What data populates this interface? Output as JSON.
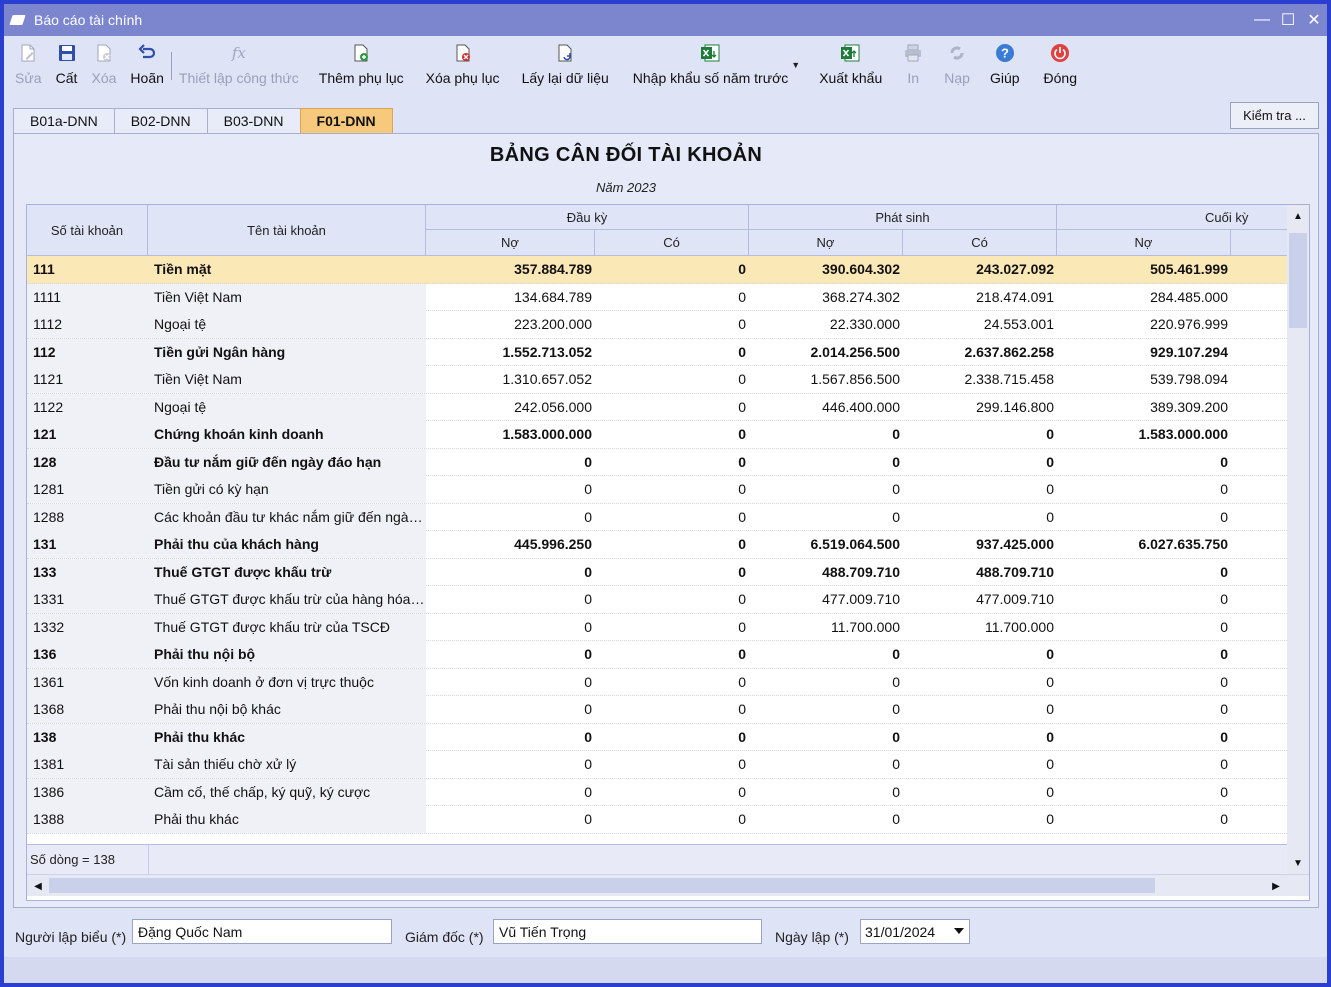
{
  "window": {
    "title": "Báo cáo tài chính"
  },
  "toolbar": {
    "items": [
      {
        "id": "edit",
        "label": "Sửa",
        "icon": "edit-doc-icon",
        "enabled": false
      },
      {
        "id": "save",
        "label": "Cất",
        "icon": "save-disk-icon",
        "enabled": true
      },
      {
        "id": "delete",
        "label": "Xóa",
        "icon": "delete-doc-icon",
        "enabled": false
      },
      {
        "id": "undo",
        "label": "Hoãn",
        "icon": "undo-arrow-icon",
        "enabled": true
      },
      {
        "id": "formula",
        "label": "Thiết lập công thức",
        "icon": "fx-formula-icon",
        "enabled": false
      },
      {
        "id": "add-appendix",
        "label": "Thêm phụ lục",
        "icon": "add-doc-icon",
        "enabled": true
      },
      {
        "id": "remove-appendix",
        "label": "Xóa phụ lục",
        "icon": "remove-doc-icon",
        "enabled": true
      },
      {
        "id": "reload",
        "label": "Lấy lại dữ liệu",
        "icon": "refresh-doc-icon",
        "enabled": true
      },
      {
        "id": "import",
        "label": "Nhập khẩu số năm trước",
        "icon": "excel-import-icon",
        "enabled": true
      },
      {
        "id": "export",
        "label": "Xuất khẩu",
        "icon": "excel-export-icon",
        "enabled": true
      },
      {
        "id": "print",
        "label": "In",
        "icon": "printer-icon",
        "enabled": false
      },
      {
        "id": "load",
        "label": "Nạp",
        "icon": "load-cycle-icon",
        "enabled": false
      },
      {
        "id": "help",
        "label": "Giúp",
        "icon": "help-icon",
        "enabled": true
      },
      {
        "id": "close",
        "label": "Đóng",
        "icon": "power-close-icon",
        "enabled": true
      }
    ]
  },
  "tabs": [
    {
      "label": "B01a-DNN",
      "active": false
    },
    {
      "label": "B02-DNN",
      "active": false
    },
    {
      "label": "B03-DNN",
      "active": false
    },
    {
      "label": "F01-DNN",
      "active": true
    }
  ],
  "check_button": {
    "label": "Kiểm tra ..."
  },
  "report": {
    "title": "BẢNG CÂN ĐỐI TÀI KHOẢN",
    "year": "Năm 2023"
  },
  "grid": {
    "headers": {
      "account_code": "Số tài khoản",
      "account_name": "Tên tài khoản",
      "opening": "Đầu kỳ",
      "movement": "Phát sinh",
      "closing": "Cuối kỳ",
      "debit": "Nợ",
      "credit": "Có"
    },
    "rows": [
      {
        "code": "111",
        "name": "Tiền mặt",
        "open_debit": "357.884.789",
        "open_credit": "0",
        "mov_debit": "390.604.302",
        "mov_credit": "243.027.092",
        "close_debit": "505.461.999",
        "bold": true,
        "selected": true
      },
      {
        "code": "1111",
        "name": "Tiền Việt Nam",
        "open_debit": "134.684.789",
        "open_credit": "0",
        "mov_debit": "368.274.302",
        "mov_credit": "218.474.091",
        "close_debit": "284.485.000",
        "bold": false
      },
      {
        "code": "1112",
        "name": "Ngoại tệ",
        "open_debit": "223.200.000",
        "open_credit": "0",
        "mov_debit": "22.330.000",
        "mov_credit": "24.553.001",
        "close_debit": "220.976.999",
        "bold": false
      },
      {
        "code": "112",
        "name": "Tiền gửi Ngân hàng",
        "open_debit": "1.552.713.052",
        "open_credit": "0",
        "mov_debit": "2.014.256.500",
        "mov_credit": "2.637.862.258",
        "close_debit": "929.107.294",
        "bold": true
      },
      {
        "code": "1121",
        "name": "Tiền Việt Nam",
        "open_debit": "1.310.657.052",
        "open_credit": "0",
        "mov_debit": "1.567.856.500",
        "mov_credit": "2.338.715.458",
        "close_debit": "539.798.094",
        "bold": false
      },
      {
        "code": "1122",
        "name": "Ngoại tệ",
        "open_debit": "242.056.000",
        "open_credit": "0",
        "mov_debit": "446.400.000",
        "mov_credit": "299.146.800",
        "close_debit": "389.309.200",
        "bold": false
      },
      {
        "code": "121",
        "name": "Chứng khoán kinh doanh",
        "open_debit": "1.583.000.000",
        "open_credit": "0",
        "mov_debit": "0",
        "mov_credit": "0",
        "close_debit": "1.583.000.000",
        "bold": true
      },
      {
        "code": "128",
        "name": "Đầu tư nắm giữ đến ngày đáo hạn",
        "open_debit": "0",
        "open_credit": "0",
        "mov_debit": "0",
        "mov_credit": "0",
        "close_debit": "0",
        "bold": true
      },
      {
        "code": "1281",
        "name": "Tiền gửi có kỳ hạn",
        "open_debit": "0",
        "open_credit": "0",
        "mov_debit": "0",
        "mov_credit": "0",
        "close_debit": "0",
        "bold": false
      },
      {
        "code": "1288",
        "name": "Các khoản đầu tư khác nắm giữ đến ngày...",
        "open_debit": "0",
        "open_credit": "0",
        "mov_debit": "0",
        "mov_credit": "0",
        "close_debit": "0",
        "bold": false
      },
      {
        "code": "131",
        "name": "Phải thu của khách hàng",
        "open_debit": "445.996.250",
        "open_credit": "0",
        "mov_debit": "6.519.064.500",
        "mov_credit": "937.425.000",
        "close_debit": "6.027.635.750",
        "bold": true
      },
      {
        "code": "133",
        "name": "Thuế GTGT được khấu trừ",
        "open_debit": "0",
        "open_credit": "0",
        "mov_debit": "488.709.710",
        "mov_credit": "488.709.710",
        "close_debit": "0",
        "bold": true
      },
      {
        "code": "1331",
        "name": "Thuế GTGT được khấu trừ của hàng hóa,...",
        "open_debit": "0",
        "open_credit": "0",
        "mov_debit": "477.009.710",
        "mov_credit": "477.009.710",
        "close_debit": "0",
        "bold": false
      },
      {
        "code": "1332",
        "name": "Thuế GTGT được khấu trừ của TSCĐ",
        "open_debit": "0",
        "open_credit": "0",
        "mov_debit": "11.700.000",
        "mov_credit": "11.700.000",
        "close_debit": "0",
        "bold": false
      },
      {
        "code": "136",
        "name": "Phải thu nội bộ",
        "open_debit": "0",
        "open_credit": "0",
        "mov_debit": "0",
        "mov_credit": "0",
        "close_debit": "0",
        "bold": true
      },
      {
        "code": "1361",
        "name": "Vốn kinh doanh ở đơn vị trực thuộc",
        "open_debit": "0",
        "open_credit": "0",
        "mov_debit": "0",
        "mov_credit": "0",
        "close_debit": "0",
        "bold": false
      },
      {
        "code": "1368",
        "name": "Phải thu nội bộ khác",
        "open_debit": "0",
        "open_credit": "0",
        "mov_debit": "0",
        "mov_credit": "0",
        "close_debit": "0",
        "bold": false
      },
      {
        "code": "138",
        "name": "Phải thu khác",
        "open_debit": "0",
        "open_credit": "0",
        "mov_debit": "0",
        "mov_credit": "0",
        "close_debit": "0",
        "bold": true
      },
      {
        "code": "1381",
        "name": "Tài sản thiếu chờ xử lý",
        "open_debit": "0",
        "open_credit": "0",
        "mov_debit": "0",
        "mov_credit": "0",
        "close_debit": "0",
        "bold": false
      },
      {
        "code": "1386",
        "name": "Cầm cố, thế chấp, ký quỹ, ký cược",
        "open_debit": "0",
        "open_credit": "0",
        "mov_debit": "0",
        "mov_credit": "0",
        "close_debit": "0",
        "bold": false
      },
      {
        "code": "1388",
        "name": "Phải thu khác",
        "open_debit": "0",
        "open_credit": "0",
        "mov_debit": "0",
        "mov_credit": "0",
        "close_debit": "0",
        "bold": false
      }
    ],
    "row_count_label": "Số dòng = 138"
  },
  "form": {
    "preparer_label": "Người lập biểu (*)",
    "preparer_value": "Đặng Quốc Nam",
    "director_label": "Giám đốc (*)",
    "director_value": "Vũ Tiến Trọng",
    "date_label": "Ngày lập (*)",
    "date_value": "31/01/2024"
  },
  "colors": {
    "titlebar": "#7b86cf",
    "active_tab": "#f7c97c",
    "selected_row": "#fbe8b7",
    "header_bg": "#dfe4f7",
    "excel_green": "#1e7c3a",
    "help_blue": "#3a7bd5",
    "close_red": "#e04040",
    "delete_red": "#d22c2c"
  }
}
